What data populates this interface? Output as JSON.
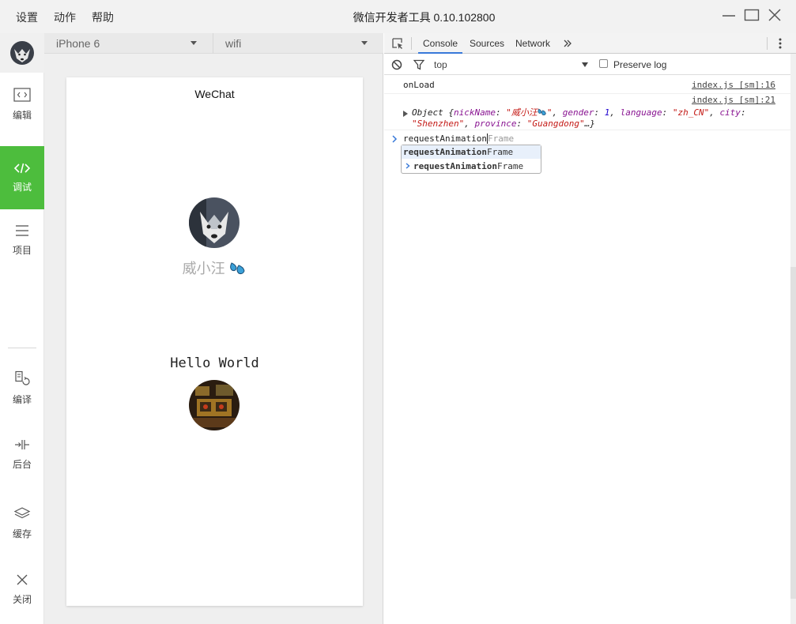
{
  "titlebar": {
    "menu": [
      "设置",
      "动作",
      "帮助"
    ],
    "title": "微信开发者工具 0.10.102800"
  },
  "sidebar": {
    "items": [
      {
        "label": "编辑",
        "icon": "code-box-icon"
      },
      {
        "label": "调试",
        "icon": "code-brackets-icon",
        "active": true
      },
      {
        "label": "项目",
        "icon": "hamburger-icon"
      },
      {
        "label": "编译",
        "icon": "compile-icon"
      },
      {
        "label": "后台",
        "icon": "background-icon"
      },
      {
        "label": "缓存",
        "icon": "layers-icon"
      },
      {
        "label": "关闭",
        "icon": "close-icon"
      }
    ],
    "active_color": "#4dbd3d"
  },
  "simulator": {
    "device": "iPhone 6",
    "network": "wifi",
    "page_title": "WeChat",
    "nickname": "威小汪",
    "hello": "Hello World"
  },
  "devtools": {
    "tabs": [
      "Console",
      "Sources",
      "Network"
    ],
    "active_tab": "Console",
    "context": "top",
    "preserve_log_label": "Preserve log",
    "logs": [
      {
        "text": "onLoad",
        "source": "index.js [sm]:16"
      },
      {
        "source": "index.js [sm]:21"
      }
    ],
    "object_log": {
      "prefix": "Object {",
      "k1": "nickName",
      "v1": "\"威小汪",
      "k2": "gender",
      "v2": "1",
      "k3": "language",
      "v3": "\"zh_CN\"",
      "k4": "city",
      "v4": "\"Shenzhen\"",
      "k5": "province",
      "v5": "\"Guangdong\"",
      "suffix": "…}"
    },
    "input": {
      "typed": "requestAnimation",
      "hint": "Frame"
    },
    "autocomplete": [
      {
        "match": "requestAnimation",
        "rest": "Frame"
      },
      {
        "match": "requestAnimation",
        "rest": "Frame"
      }
    ]
  }
}
